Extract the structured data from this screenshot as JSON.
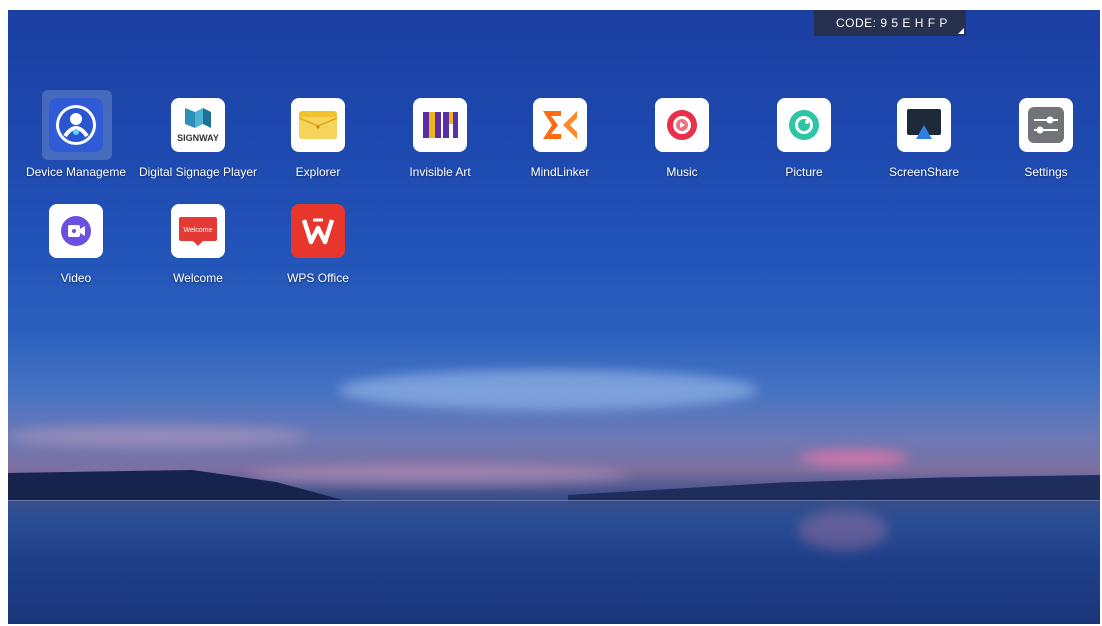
{
  "status": {
    "code_label": "CODE:",
    "code_value": "9 5 E H F P"
  },
  "apps": [
    {
      "label": "Device Manageme",
      "icon": "device-management-icon",
      "color": "#2f5bd6"
    },
    {
      "label": "Digital Signage Player",
      "icon": "signway-icon",
      "icon_text": "SIGNWAY",
      "color": "#ffffff"
    },
    {
      "label": "Explorer",
      "icon": "folder-icon",
      "color": "#f2c12e"
    },
    {
      "label": "Invisible Art",
      "icon": "invisible-art-icon",
      "color": "#5b2fa8"
    },
    {
      "label": "MindLinker",
      "icon": "mindlinker-icon",
      "color": "#ff6a13"
    },
    {
      "label": "Music",
      "icon": "music-icon",
      "color": "#e8304a"
    },
    {
      "label": "Picture",
      "icon": "picture-icon",
      "color": "#2ec4a6"
    },
    {
      "label": "ScreenShare",
      "icon": "screenshare-icon",
      "color": "#1e2a3a"
    },
    {
      "label": "Settings",
      "icon": "settings-icon",
      "color": "#707478"
    },
    {
      "label": "Video",
      "icon": "video-icon",
      "color": "#6b4fe0"
    },
    {
      "label": "Welcome",
      "icon": "welcome-icon",
      "icon_text": "Welcome",
      "color": "#e53935"
    },
    {
      "label": "WPS Office",
      "icon": "wps-office-icon",
      "color": "#e8362d"
    }
  ]
}
